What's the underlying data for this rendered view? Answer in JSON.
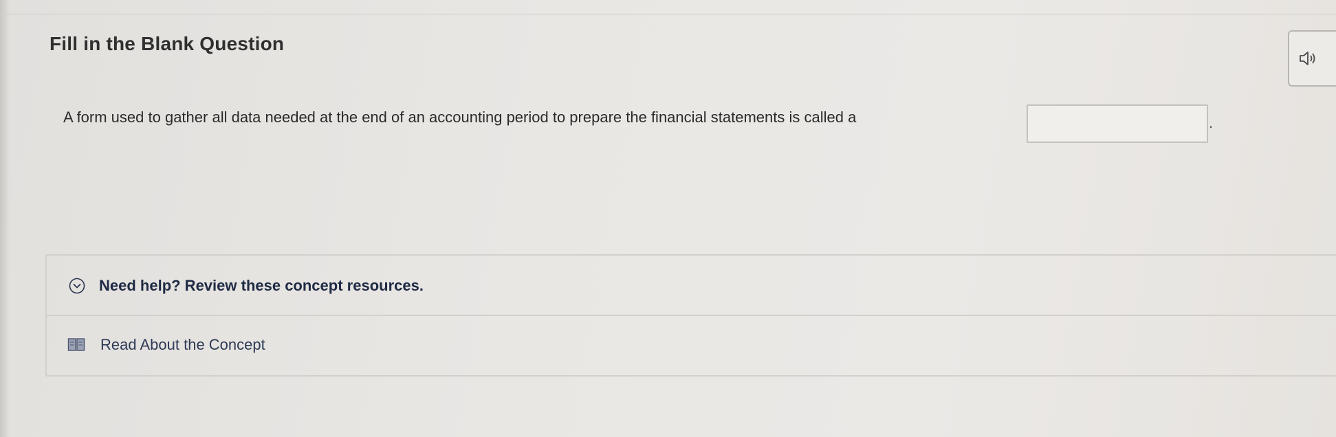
{
  "question": {
    "title": "Fill in the Blank Question",
    "text": "A form used to gather all data needed at the end of an accounting period to prepare the financial statements is called a",
    "blank_value": "",
    "after_blank": "."
  },
  "toolbar": {
    "audio_icon": "speaker-icon"
  },
  "resources": {
    "help_label": "Need help? Review these concept resources.",
    "help_icon": "chevron-down-circle-icon",
    "items": [
      {
        "label": "Read About the Concept",
        "icon": "book-icon"
      }
    ]
  },
  "colors": {
    "background": "#e9e7e4",
    "help_text": "#1f2a44",
    "border": "#d3d0cc"
  }
}
